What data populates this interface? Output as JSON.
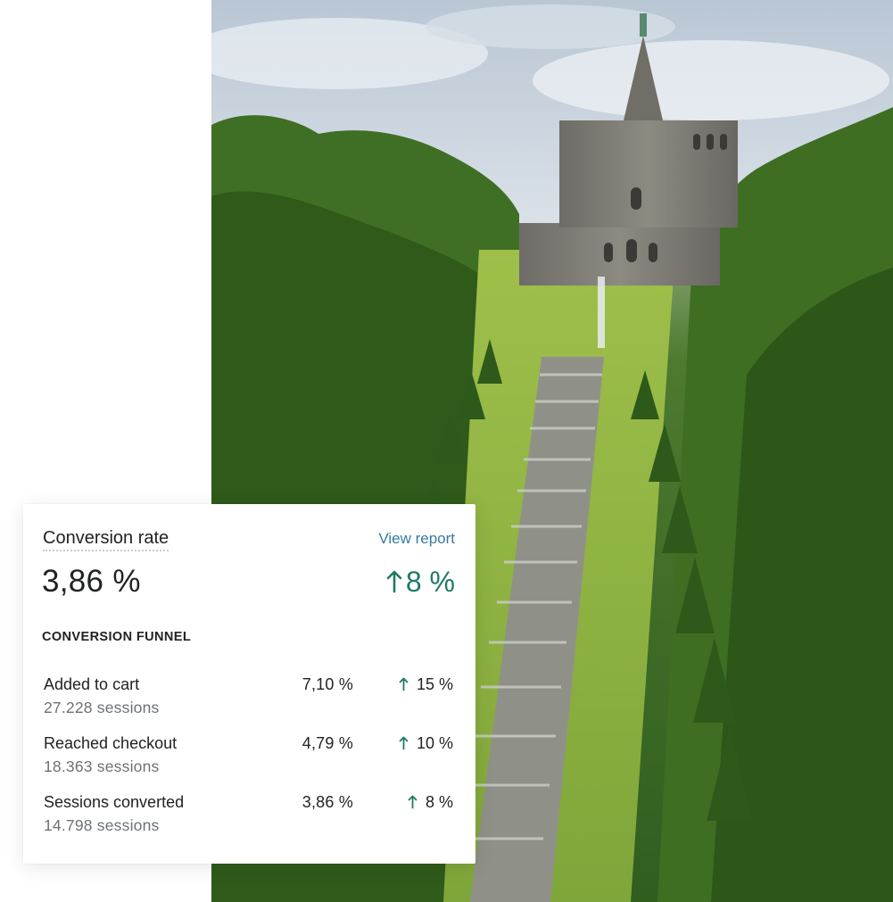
{
  "card": {
    "metric_title": "Conversion rate",
    "view_report_label": "View report",
    "metric_value": "3,86 %",
    "metric_change": "8 %",
    "funnel_heading": "CONVERSION FUNNEL",
    "funnel_rows": [
      {
        "label": "Added to cart",
        "sessions": "27.228 sessions",
        "rate": "7,10 %",
        "change": "15 %"
      },
      {
        "label": "Reached checkout",
        "sessions": "18.363 sessions",
        "rate": "4,79 %",
        "change": "10 %"
      },
      {
        "label": "Sessions converted",
        "sessions": "14.798 sessions",
        "rate": "3,86 %",
        "change": "8 %"
      }
    ]
  },
  "colors": {
    "positive": "#1f7a64",
    "link": "#3a7aa1"
  },
  "icons": {
    "trend": "arrow-up-icon"
  }
}
